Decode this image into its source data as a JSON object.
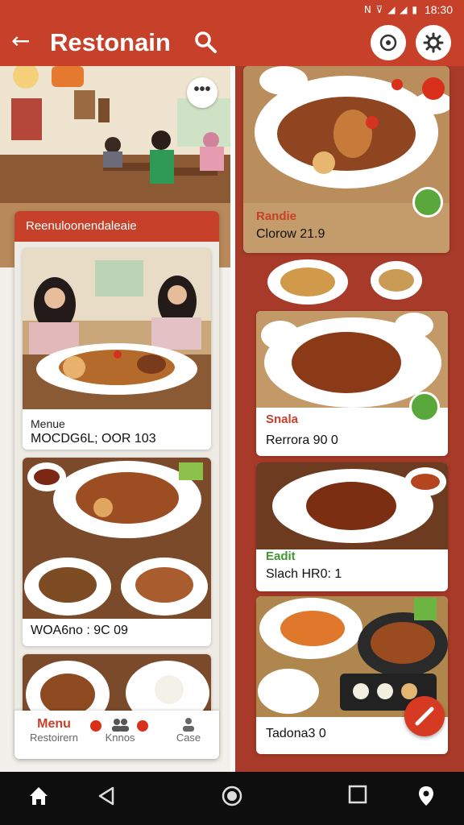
{
  "status": {
    "time": "18:30",
    "icons": "N ⊽ ◢ ◢ ▮"
  },
  "appbar": {
    "title": "Restonain",
    "back_icon": "back-arrow-icon",
    "search_icon": "search-icon"
  },
  "left": {
    "panel_title": "Reenuloonendaleaie",
    "cards": [
      {
        "title": "Menue",
        "subtitle": "MOCDG6L; OOR 103"
      },
      {
        "subtitle": "WOA6no : 9C 09"
      }
    ]
  },
  "right": {
    "cards": [
      {
        "name": "Randie",
        "price": "Clorow 21.9"
      },
      {
        "name": "Snala",
        "price": "Rerrora 90  0"
      },
      {
        "name": "Eadit",
        "price": "Slach HR0:  1"
      },
      {
        "price": "Tadona3  0"
      }
    ]
  },
  "tabs": [
    {
      "top": "Menu",
      "label": "Restoirern",
      "icon": "menu-icon",
      "active": true
    },
    {
      "top": "",
      "label": "Knnos",
      "icon": "people-icon",
      "active": false
    },
    {
      "top": "",
      "label": "Case",
      "icon": "person-icon",
      "active": false
    }
  ],
  "colors": {
    "brand": "#c6402a",
    "accent_green": "#5aa83b"
  }
}
